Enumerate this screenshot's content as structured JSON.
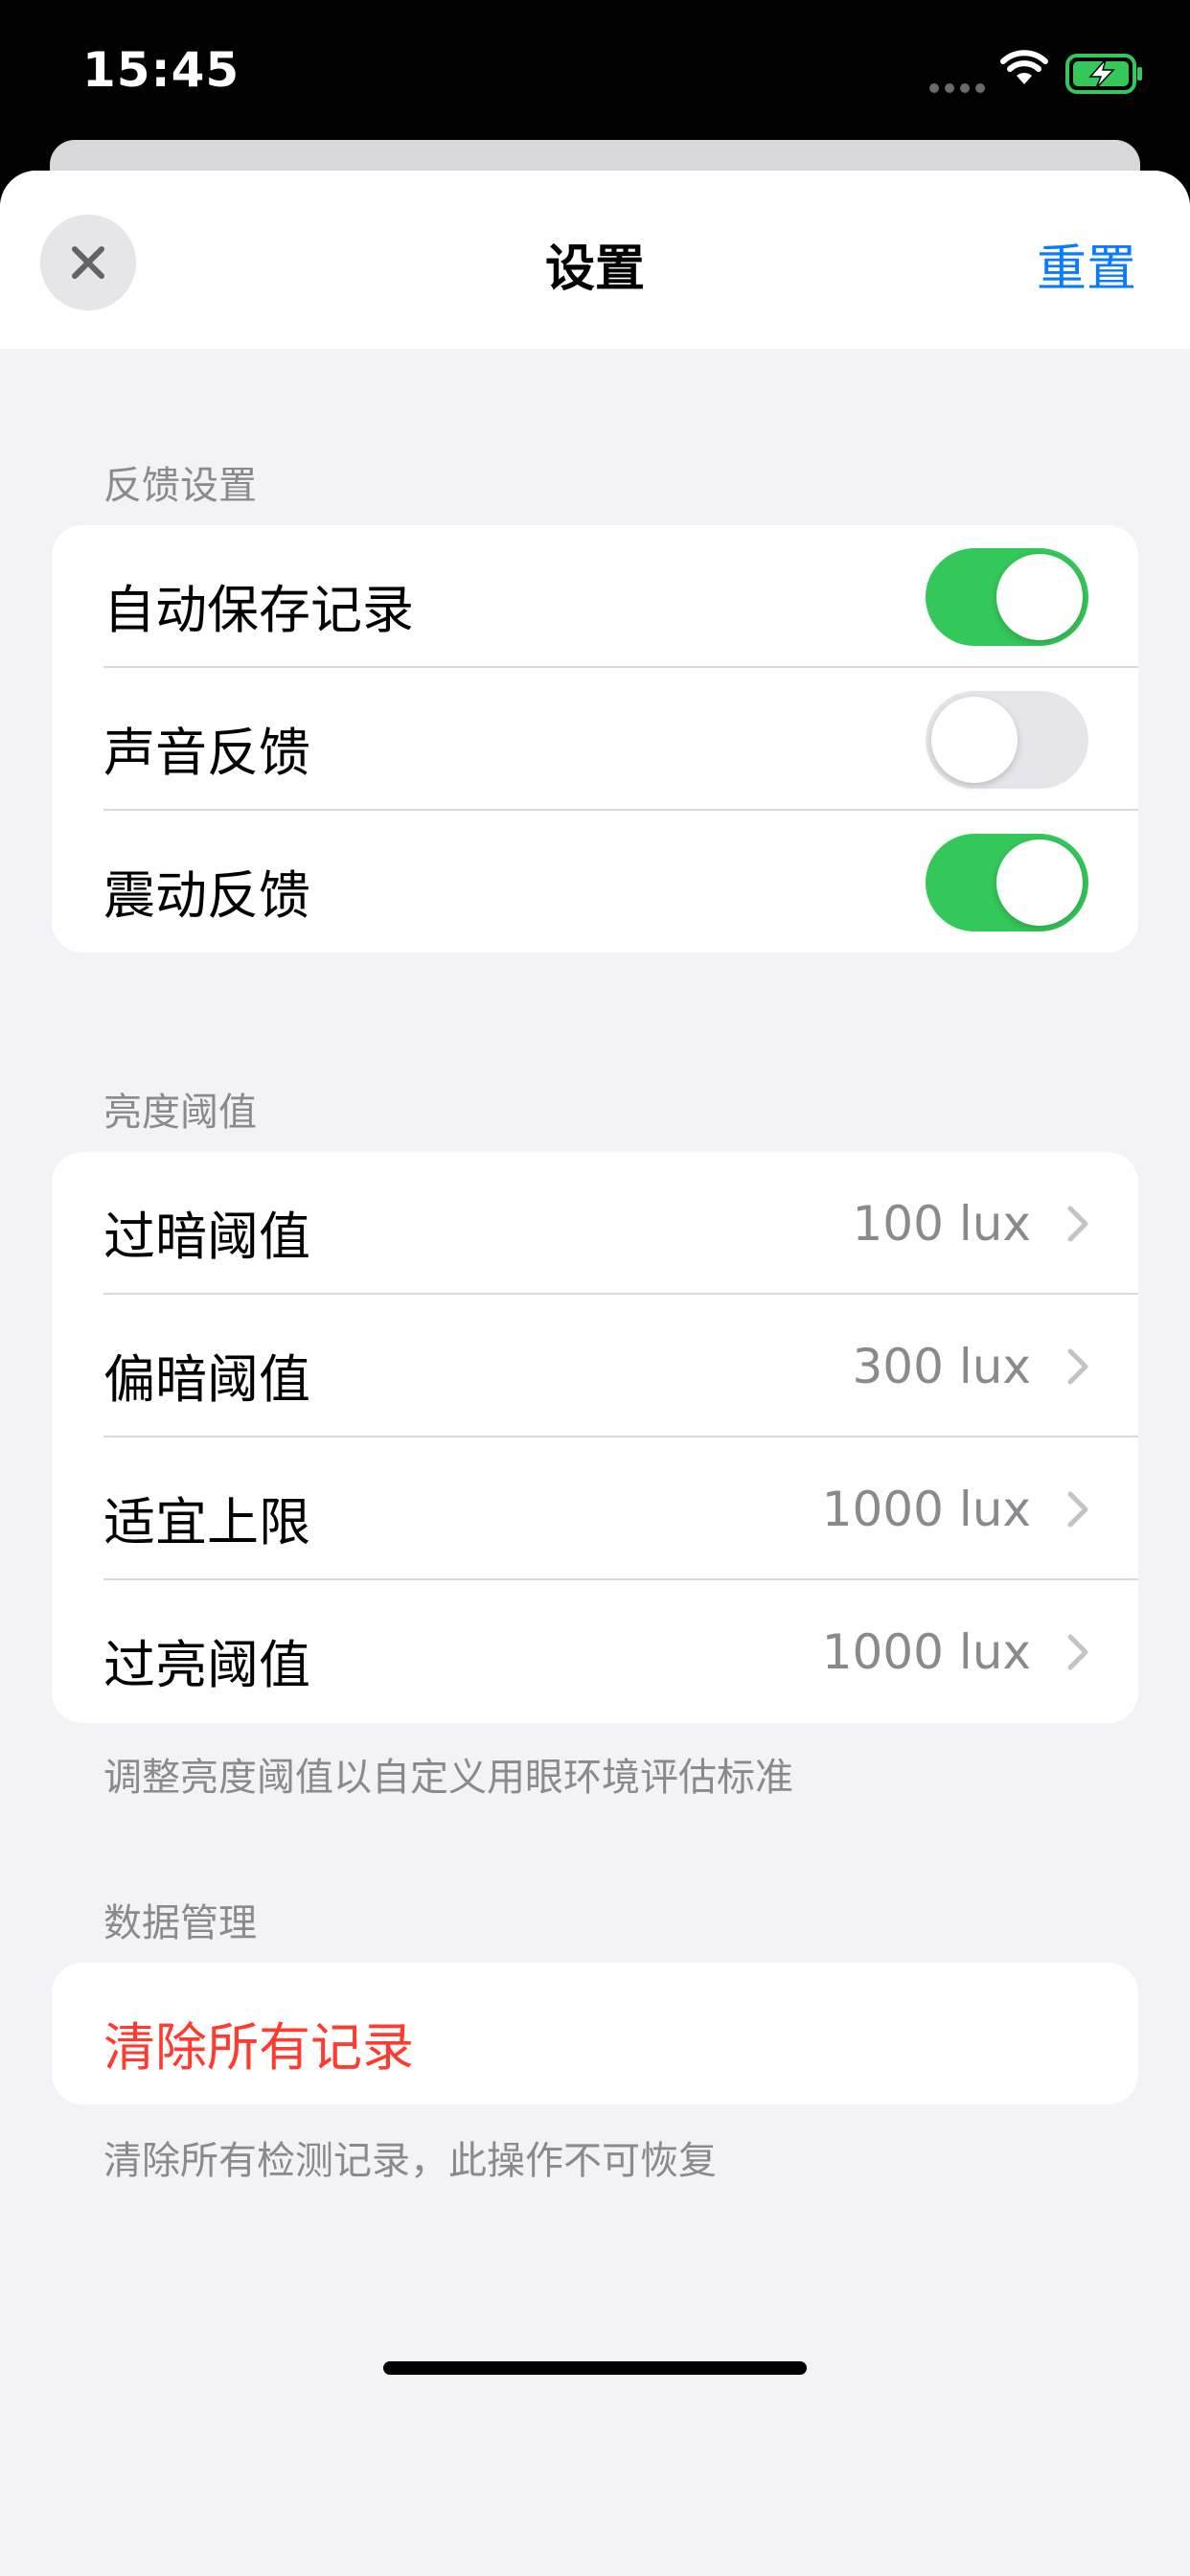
{
  "status_bar": {
    "time": "15:45",
    "icons": [
      "signal-icon",
      "wifi-icon",
      "battery-charging-icon"
    ],
    "battery_color": "#34c759"
  },
  "nav": {
    "title": "设置",
    "reset_label": "重置",
    "close_icon": "close-icon"
  },
  "sections": {
    "feedback": {
      "header": "反馈设置",
      "rows": [
        {
          "label": "自动保存记录",
          "on": true
        },
        {
          "label": "声音反馈",
          "on": false
        },
        {
          "label": "震动反馈",
          "on": true
        }
      ]
    },
    "brightness": {
      "header": "亮度阈值",
      "rows": [
        {
          "label": "过暗阈值",
          "value": "100 lux"
        },
        {
          "label": "偏暗阈值",
          "value": "300 lux"
        },
        {
          "label": "适宜上限",
          "value": "1000 lux"
        },
        {
          "label": "过亮阈值",
          "value": "1000 lux"
        }
      ],
      "footer": "调整亮度阈值以自定义用眼环境评估标准"
    },
    "data": {
      "header": "数据管理",
      "clear_label": "清除所有记录",
      "footer": "清除所有检测记录，此操作不可恢复"
    }
  },
  "colors": {
    "accent": "#0a7aff",
    "toggle_on": "#34c759",
    "destructive": "#ff3b30",
    "background": "#f2f2f7"
  }
}
